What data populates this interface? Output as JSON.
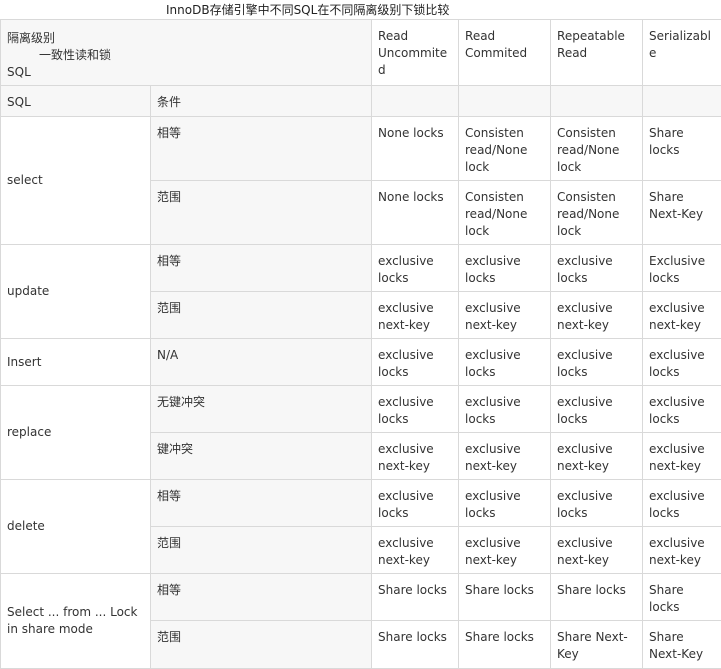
{
  "title": "InnoDB存储引擎中不同SQL在不同隔离级别下锁比较",
  "header": {
    "isolation_label": "隔离级别",
    "consistent_read_label": "一致性读和锁",
    "sql_label": "SQL",
    "levels": [
      "Read Uncommited",
      "Read Commited",
      "Repeatable Read",
      "Serializable"
    ]
  },
  "subheader": {
    "sql": "SQL",
    "condition": "条件"
  },
  "groups": [
    {
      "sql": "select",
      "rows": [
        {
          "condition": "相等",
          "cells": [
            "None locks",
            "Consisten read/None lock",
            "Consisten read/None lock",
            "Share locks"
          ]
        },
        {
          "condition": "范围",
          "cells": [
            "None locks",
            "Consisten read/None lock",
            "Consisten read/None lock",
            "Share Next-Key"
          ]
        }
      ]
    },
    {
      "sql": "update",
      "rows": [
        {
          "condition": "相等",
          "cells": [
            "exclusive locks",
            "exclusive locks",
            "exclusive locks",
            "Exclusive locks"
          ]
        },
        {
          "condition": "范围",
          "cells": [
            "exclusive next-key",
            "exclusive next-key",
            "exclusive next-key",
            "exclusive next-key"
          ]
        }
      ]
    },
    {
      "sql": "Insert",
      "rows": [
        {
          "condition": "N/A",
          "cells": [
            "exclusive locks",
            "exclusive locks",
            "exclusive locks",
            "exclusive locks"
          ]
        }
      ]
    },
    {
      "sql": "replace",
      "rows": [
        {
          "condition": "无键冲突",
          "cells": [
            "exclusive locks",
            "exclusive locks",
            "exclusive locks",
            "exclusive locks"
          ]
        },
        {
          "condition": "键冲突",
          "cells": [
            "exclusive next-key",
            "exclusive next-key",
            "exclusive next-key",
            "exclusive next-key"
          ]
        }
      ]
    },
    {
      "sql": "delete",
      "rows": [
        {
          "condition": "相等",
          "cells": [
            "exclusive locks",
            "exclusive locks",
            "exclusive locks",
            "exclusive locks"
          ]
        },
        {
          "condition": "范围",
          "cells": [
            "exclusive next-key",
            "exclusive next-key",
            "exclusive next-key",
            "exclusive next-key"
          ]
        }
      ]
    },
    {
      "sql": "Select ... from ... Lock in share mode",
      "rows": [
        {
          "condition": "相等",
          "cells": [
            "Share locks",
            "Share locks",
            "Share locks",
            "Share locks"
          ]
        },
        {
          "condition": "范围",
          "cells": [
            "Share locks",
            "Share locks",
            "Share Next-Key",
            "Share Next-Key"
          ]
        }
      ]
    }
  ]
}
